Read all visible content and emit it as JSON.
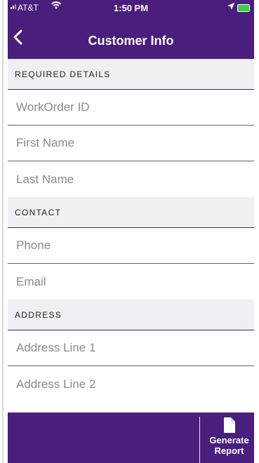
{
  "status_bar": {
    "carrier": "AT&T",
    "time": "1:50 PM"
  },
  "nav": {
    "title": "Customer Info"
  },
  "sections": {
    "required": {
      "header": "REQUIRED DETAILS",
      "fields": {
        "workorder": "WorkOrder ID",
        "first_name": "First Name",
        "last_name": "Last Name"
      }
    },
    "contact": {
      "header": "CONTACT",
      "fields": {
        "phone": "Phone",
        "email": "Email"
      }
    },
    "address": {
      "header": "ADDRESS",
      "fields": {
        "line1": "Address Line 1",
        "line2": "Address Line 2"
      }
    }
  },
  "toolbar": {
    "generate_line1": "Generate",
    "generate_line2": "Report"
  },
  "colors": {
    "brand": "#4a1e7d",
    "section_bg": "#efeff4"
  }
}
